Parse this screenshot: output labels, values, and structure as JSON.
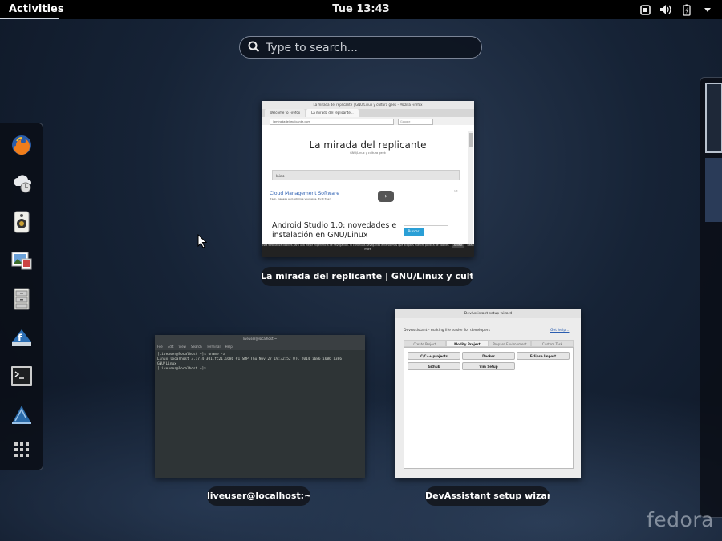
{
  "topbar": {
    "activities": "Activities",
    "clock": "Tue 13:43",
    "tray_icons": [
      "screen-icon",
      "volume-icon",
      "battery-icon",
      "dropdown-icon"
    ]
  },
  "search": {
    "placeholder": "Type to search..."
  },
  "dash": {
    "apps": [
      "firefox-icon",
      "backup-icon",
      "speaker-icon",
      "image-viewer-icon",
      "file-manager-icon",
      "software-icon",
      "terminal-icon",
      "devassistant-icon",
      "show-apps-icon"
    ]
  },
  "windows": {
    "firefox": {
      "caption": "La mirada del replicante | GNU/Linux y cultura ...",
      "titlebar": "La mirada del replicante | GNU/Linux y cultura geek - Mozilla Firefox",
      "tab1": "Welcome to Firefox",
      "tab2": "La mirada del replicante...",
      "url": "lamiradadelreplicante.com",
      "search": "Google",
      "heading": "La mirada del replicante",
      "subheading": "GNU/Linux y cultura geek",
      "menu": "Inicio",
      "ad_title": "Cloud Management Software",
      "ad_sub": "Track, manage and optimize your apps. Try it free!",
      "post_title": "Android Studio 1.0: novedades e instalación en GNU/Linux",
      "search_button": "Buscar",
      "cookie_text": "Esta web utiliza cookies para una mejor experiencia de navegación. Si continúas navegando entendemos que aceptas nuestra política de cookies",
      "cookie_accept": "Accept",
      "cookie_more": "Read more"
    },
    "terminal": {
      "caption": "liveuser@localhost:~",
      "titlebar": "liveuser@localhost:~",
      "menu": [
        "File",
        "Edit",
        "View",
        "Search",
        "Terminal",
        "Help"
      ],
      "lines": "[liveuser@localhost ~]$ uname -a\nLinux localhost 3.17.4-301.fc21.i686 #1 SMP Thu Nov 27 19:32:52 UTC 2014 i686 i686 i386 GNU/Linux\n[liveuser@localhost ~]$ "
    },
    "devassistant": {
      "caption": "DevAssistant setup wizard",
      "titlebar": "DevAssistant setup wizard",
      "intro": "DevAssistant - making life easier for developers",
      "help": "Get help...",
      "tabs": [
        "Create Project",
        "Modify Project",
        "Prepare Environment",
        "Custom Task"
      ],
      "buttons": [
        "C/C++ projects",
        "Docker",
        "Eclipse Import",
        "Github",
        "Vim Setup"
      ]
    }
  },
  "branding": {
    "logo": "fedora"
  }
}
